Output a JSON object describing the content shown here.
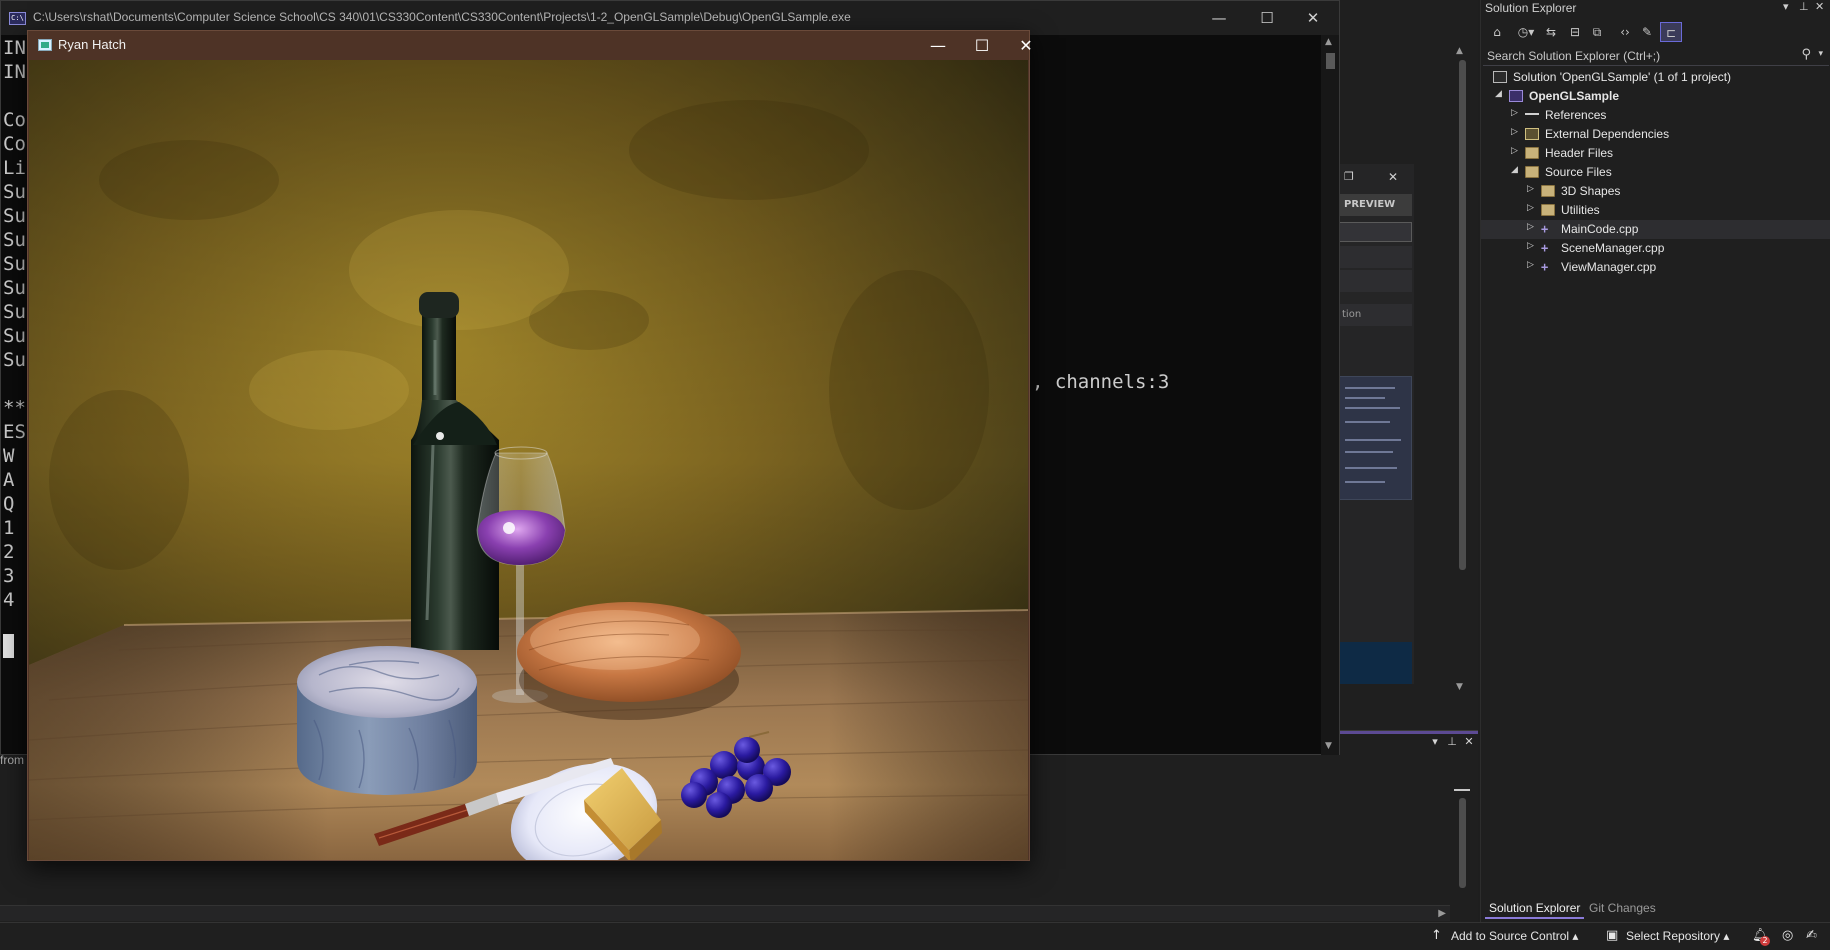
{
  "console": {
    "path": "C:\\Users\\rshat\\Documents\\Computer Science School\\CS 340\\01\\CS330Content\\CS330Content\\Projects\\1-2_OpenGLSample\\Debug\\OpenGLSample.exe",
    "icon_text": "C:\\",
    "left_lines": [
      "IN",
      "IN",
      "",
      "Co",
      "Co",
      "Li",
      "Su",
      "Su",
      "Su",
      "Su",
      "Su",
      "Su",
      "Su",
      "Su",
      "",
      "**",
      "ES",
      "W",
      "A",
      "Q",
      "1",
      "2",
      "3",
      "4"
    ],
    "visible_fragment": ", channels:3",
    "from_label": "from"
  },
  "gl_window": {
    "title": "Ryan Hatch"
  },
  "preview_panel": {
    "tab_label": "PREVIEW",
    "row_text": "tion"
  },
  "solution_explorer": {
    "title": "Solution Explorer",
    "search_placeholder": "Search Solution Explorer (Ctrl+;)",
    "tree": [
      {
        "label": "Solution 'OpenGLSample' (1 of 1 project)",
        "icon": "solution-icon"
      },
      {
        "label": "OpenGLSample",
        "icon": "project-icon",
        "bold": true
      },
      {
        "label": "References",
        "icon": "references-icon"
      },
      {
        "label": "External Dependencies",
        "icon": "external-dependencies-icon"
      },
      {
        "label": "Header Files",
        "icon": "folder-icon"
      },
      {
        "label": "Source Files",
        "icon": "folder-icon"
      },
      {
        "label": "3D Shapes",
        "icon": "folder-icon"
      },
      {
        "label": "Utilities",
        "icon": "folder-icon"
      },
      {
        "label": "MainCode.cpp",
        "icon": "cpp-file-icon",
        "selected": true
      },
      {
        "label": "SceneManager.cpp",
        "icon": "cpp-file-icon"
      },
      {
        "label": "ViewManager.cpp",
        "icon": "cpp-file-icon"
      }
    ],
    "tabs": [
      "Solution Explorer",
      "Git Changes"
    ]
  },
  "status_bar": {
    "add_to_source_control": "Add to Source Control",
    "select_repository": "Select Repository",
    "notification_count": "2"
  },
  "colors": {
    "gl_titlebar": "#4e3326",
    "vs_background": "#1f1f1f",
    "console_background": "#0c0c0c",
    "selection": "#2d2d30",
    "accent": "#8a7ad8"
  }
}
